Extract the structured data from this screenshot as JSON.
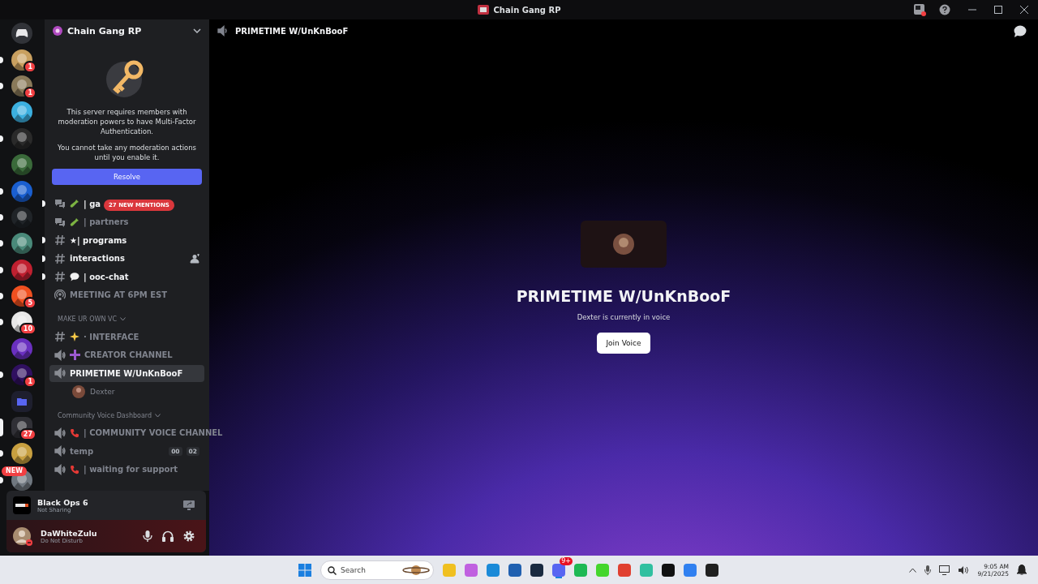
{
  "window": {
    "title": "Chain Gang RP"
  },
  "servers": [
    {
      "kind": "home",
      "unread": false,
      "selected": false
    },
    {
      "kind": "server",
      "color": "#c9a060",
      "unread": true,
      "selected": false,
      "badge": "1"
    },
    {
      "kind": "server",
      "color": "#8a7a5a",
      "unread": true,
      "selected": false,
      "badge": "1"
    },
    {
      "kind": "server",
      "color": "#3cb0e0",
      "unread": false,
      "selected": false
    },
    {
      "kind": "server",
      "color": "#2a2a2a",
      "unread": true,
      "selected": false
    },
    {
      "kind": "server",
      "color": "#3a6a3a",
      "unread": false,
      "selected": false
    },
    {
      "kind": "server",
      "color": "#1a5fd0",
      "unread": true,
      "selected": false
    },
    {
      "kind": "server",
      "color": "#202428",
      "unread": true,
      "selected": false
    },
    {
      "kind": "server",
      "color": "#4a8a7a",
      "unread": true,
      "selected": false
    },
    {
      "kind": "server",
      "color": "#c02030",
      "unread": true,
      "selected": false
    },
    {
      "kind": "server",
      "color": "#f05020",
      "unread": true,
      "selected": false,
      "badge": "5"
    },
    {
      "kind": "server",
      "color": "#e8e8e8",
      "unread": true,
      "selected": false,
      "badge": "10"
    },
    {
      "kind": "server",
      "color": "#6a30c0",
      "unread": false,
      "selected": false
    },
    {
      "kind": "server",
      "color": "#301060",
      "unread": true,
      "selected": false,
      "badge": "1"
    },
    {
      "kind": "folder",
      "color": "#5865f2",
      "unread": false,
      "selected": false
    },
    {
      "kind": "server",
      "color": "#303036",
      "unread": false,
      "selected": true,
      "badge": "27"
    },
    {
      "kind": "server",
      "color": "#c8a040",
      "unread": true,
      "selected": false
    },
    {
      "kind": "server",
      "color": "#707880",
      "unread": true,
      "selected": false,
      "new_badge": "NEW"
    }
  ],
  "server_header": {
    "name": "Chain Gang RP"
  },
  "mfa_notice": {
    "text": "This server requires members with moderation powers to have Multi-Factor Authentication.",
    "detail": "You cannot take any moderation actions until you enable it.",
    "button": "Resolve"
  },
  "mentions_pill": "27 NEW MENTIONS",
  "channels": [
    {
      "kind": "forum",
      "name": "| ga",
      "unread": true,
      "selected": false
    },
    {
      "kind": "forum",
      "name": "| partners",
      "unread": false,
      "selected": false
    },
    {
      "kind": "text",
      "name": "★| programs",
      "unread": true,
      "selected": false
    },
    {
      "kind": "text",
      "name": "interactions",
      "unread": true,
      "selected": false,
      "invite": true
    },
    {
      "kind": "text",
      "name": "| ooc-chat",
      "unread": true,
      "selected": false
    },
    {
      "kind": "stage",
      "name": "MEETING AT 6PM EST",
      "unread": false,
      "selected": false
    },
    {
      "kind": "category",
      "name": "MAKE UR OWN VC"
    },
    {
      "kind": "text",
      "name": "· INTERFACE",
      "unread": false,
      "selected": false
    },
    {
      "kind": "voice",
      "name": "CREATOR CHANNEL",
      "unread": false,
      "selected": false
    },
    {
      "kind": "voice",
      "name": "PRIMETIME W/UnKnBooF",
      "unread": false,
      "selected": true
    },
    {
      "kind": "member",
      "name": "Dexter"
    },
    {
      "kind": "category",
      "name": "Community Voice Dashboard"
    },
    {
      "kind": "voice",
      "name": "| COMMUNITY VOICE CHANNEL",
      "unread": false,
      "selected": false
    },
    {
      "kind": "voice",
      "name": "temp",
      "unread": false,
      "selected": false,
      "counters": [
        "00",
        "02"
      ]
    },
    {
      "kind": "voice",
      "name": "| waiting for support",
      "unread": false,
      "selected": false
    }
  ],
  "activity": {
    "game": "Black Ops 6",
    "status": "Not Sharing"
  },
  "user": {
    "name": "DaWhiteZulu",
    "status": "Do Not Disturb"
  },
  "header": {
    "channel": "PRIMETIME W/UnKnBooF"
  },
  "voice_view": {
    "title": "PRIMETIME W/UnKnBooF",
    "status": "Dexter is currently in voice",
    "button": "Join Voice"
  },
  "taskbar": {
    "search_placeholder": "Search",
    "apps": [
      {
        "color": "#f0c020",
        "active": false
      },
      {
        "color": "#c060e0",
        "active": false
      },
      {
        "color": "#1a8ad8",
        "active": false
      },
      {
        "color": "#2060b0",
        "active": false
      },
      {
        "color": "#1a2a40",
        "active": false
      },
      {
        "color": "#5865f2",
        "active": true,
        "badge": "9+"
      },
      {
        "color": "#1db954",
        "active": false
      },
      {
        "color": "#44d62c",
        "active": false
      },
      {
        "color": "#e04030",
        "active": false
      },
      {
        "color": "#30c0a0",
        "active": false
      },
      {
        "color": "#111111",
        "active": false
      },
      {
        "color": "#3080f0",
        "active": false
      },
      {
        "color": "#202020",
        "active": false
      }
    ],
    "time": "9:05 AM",
    "date": "9/21/2025"
  }
}
